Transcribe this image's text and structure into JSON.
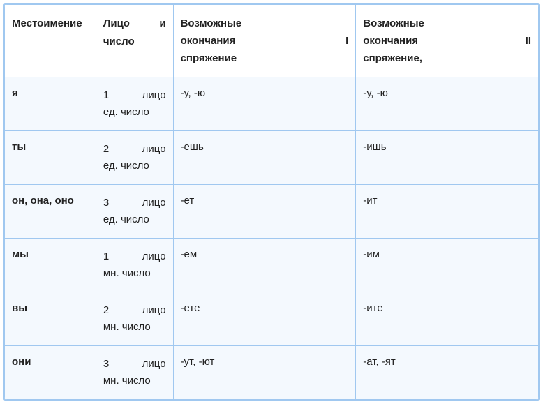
{
  "headers": {
    "pronoun": "Местоимение",
    "person": "Лицо и число",
    "endings1_line1": "Возможные",
    "endings1_line2_left": "окончания",
    "endings1_line2_right": "I",
    "endings1_line3": "спряжение",
    "endings2_line1": "Возможные",
    "endings2_line2_left": "окончания",
    "endings2_line2_right": "II",
    "endings2_line3": "спряжение,"
  },
  "rows": [
    {
      "pronoun": "я",
      "pnum": "1",
      "pword": "лицо",
      "pline2": "ед. число",
      "e1_plain": "-у, -ю",
      "e1_u": "",
      "e2_plain": "-у, -ю",
      "e2_u": ""
    },
    {
      "pronoun": "ты",
      "pnum": "2",
      "pword": "лицо",
      "pline2": "ед. число",
      "e1_plain": "-еш",
      "e1_u": "ь",
      "e2_plain": "-иш",
      "e2_u": "ь"
    },
    {
      "pronoun": "он, она, оно",
      "pnum": "3",
      "pword": "лицо",
      "pline2": "ед. число",
      "e1_plain": "-ет",
      "e1_u": "",
      "e2_plain": "-ит",
      "e2_u": ""
    },
    {
      "pronoun": "мы",
      "pnum": "1",
      "pword": "лицо",
      "pline2": "мн. число",
      "e1_plain": "-ем",
      "e1_u": "",
      "e2_plain": "-им",
      "e2_u": ""
    },
    {
      "pronoun": "вы",
      "pnum": "2",
      "pword": "лицо",
      "pline2": "мн. число",
      "e1_plain": "-ете",
      "e1_u": "",
      "e2_plain": "-ите",
      "e2_u": ""
    },
    {
      "pronoun": "они",
      "pnum": "3",
      "pword": "лицо",
      "pline2": "мн. число",
      "e1_plain": "-ут, -ют",
      "e1_u": "",
      "e2_plain": "-ат, -ят",
      "e2_u": ""
    }
  ]
}
